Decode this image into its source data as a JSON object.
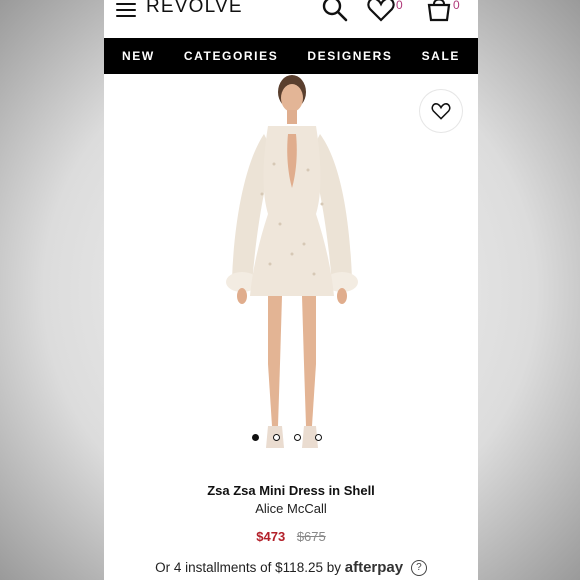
{
  "header": {
    "logo": "REVOLVE",
    "wishlist_count": "0",
    "bag_count": "0"
  },
  "nav": {
    "items": [
      "NEW",
      "CATEGORIES",
      "DESIGNERS",
      "SALE"
    ]
  },
  "product": {
    "title": "Zsa Zsa Mini Dress in Shell",
    "brand": "Alice McCall",
    "sale_price": "$473",
    "original_price": "$675",
    "image_count": 4,
    "active_image": 1
  },
  "installments": {
    "text": "Or 4 installments of $118.25 by",
    "provider": "afterpay",
    "help": "?"
  },
  "colors": {
    "accent_count": "#b03a7a",
    "sale": "#b3202a",
    "nav_bg": "#000000"
  },
  "icons": [
    "menu-icon",
    "search-icon",
    "heart-icon",
    "bag-icon",
    "help-icon"
  ]
}
